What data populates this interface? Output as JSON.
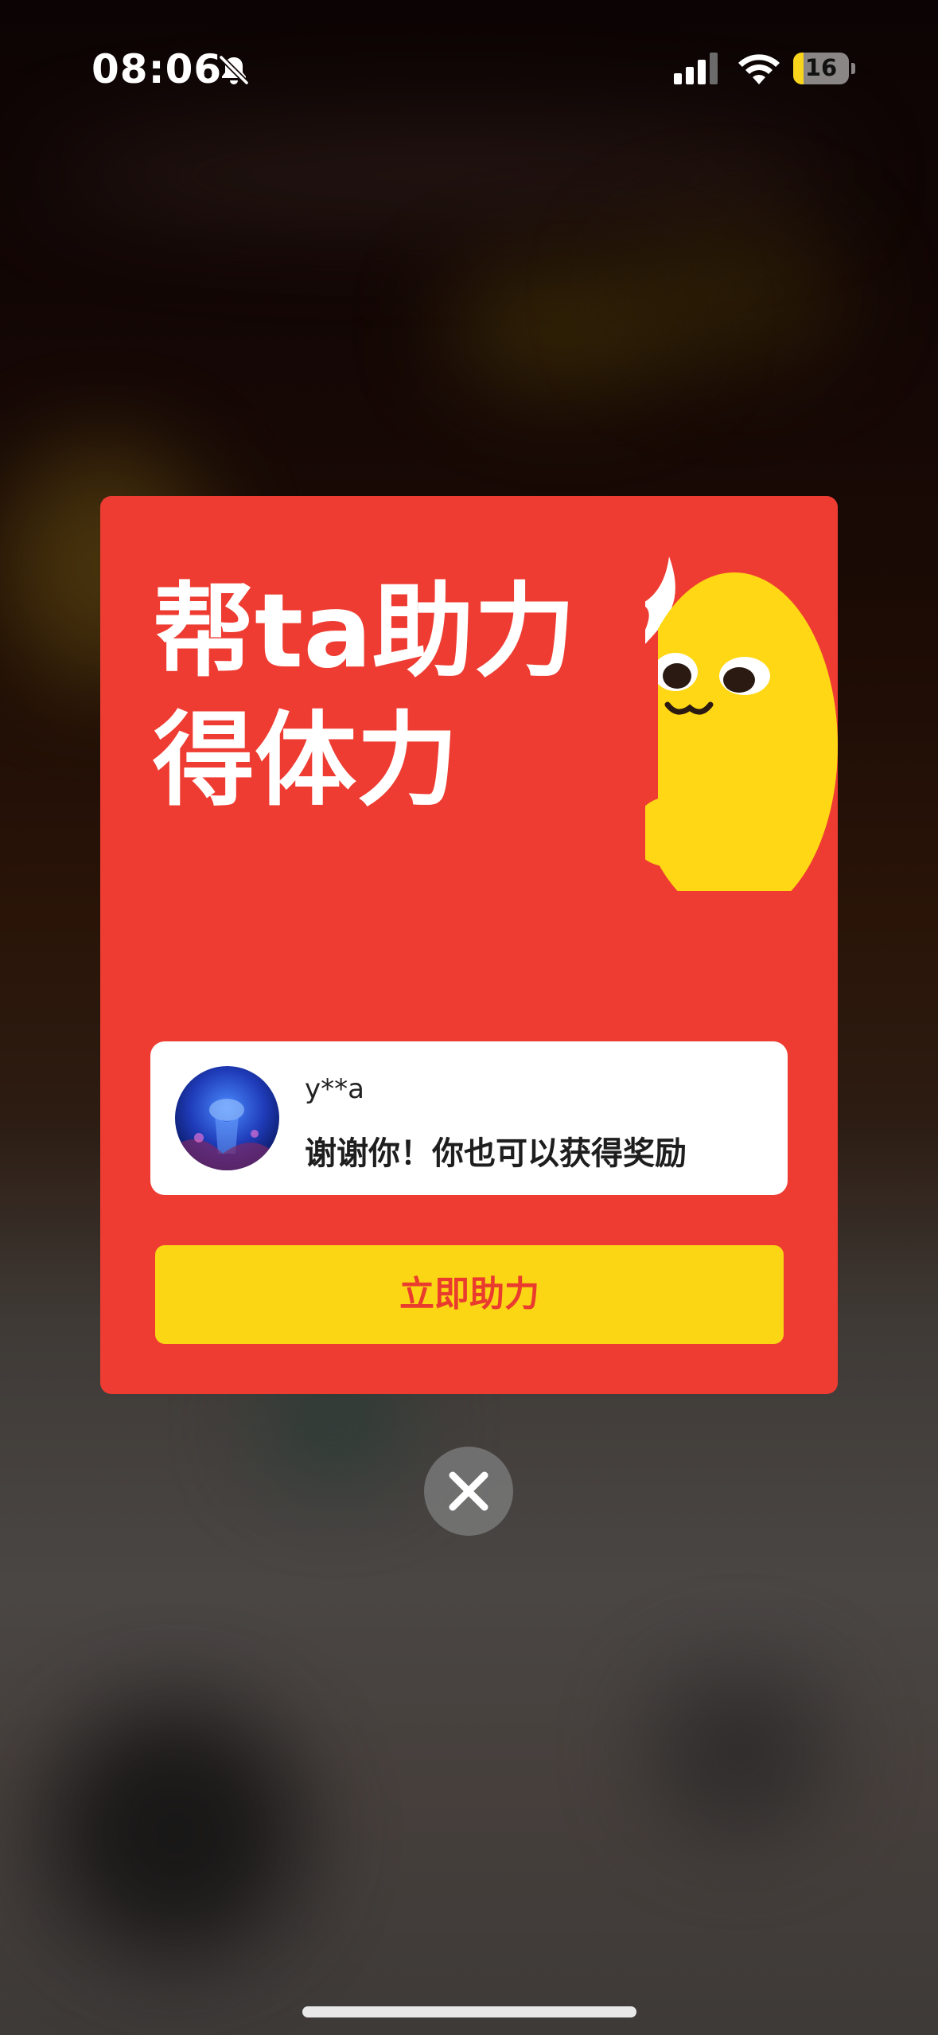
{
  "status_bar": {
    "time": "08:06",
    "battery_level": "16",
    "icons": [
      "bell-slash-icon",
      "signal-icon",
      "wifi-icon",
      "battery-icon"
    ]
  },
  "popup": {
    "headline_line1": "帮ta助力",
    "headline_line2": "得体力",
    "message": {
      "username": "y**a",
      "text": "谢谢你！你也可以获得奖励"
    },
    "cta_label": "立即助力"
  },
  "colors": {
    "card_red": "#ee3c32",
    "button_yellow": "#fbd615",
    "button_text": "#ea3c2e",
    "mascot_yellow": "#ffd714"
  }
}
